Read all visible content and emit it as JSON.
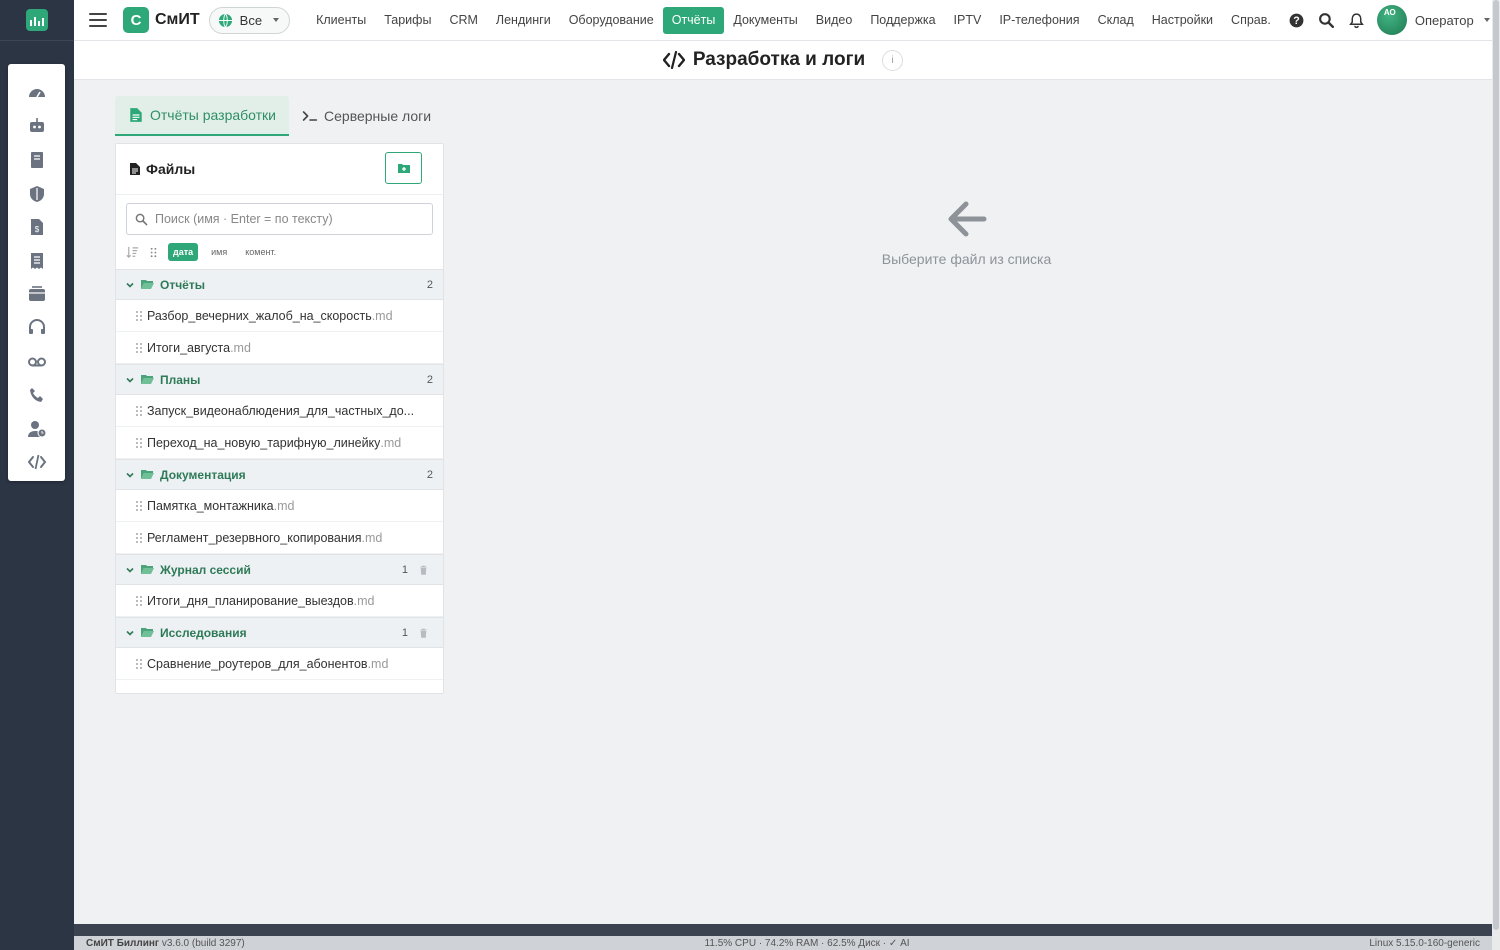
{
  "app": {
    "brand_letter": "С",
    "brand_name": "СмИТ",
    "scope_label": "Все"
  },
  "nav": {
    "items": [
      "Клиенты",
      "Тарифы",
      "CRM",
      "Лендинги",
      "Оборудование",
      "Отчёты",
      "Документы",
      "Видео",
      "Поддержка",
      "IPTV",
      "IP-телефония",
      "Склад",
      "Настройки",
      "Справ."
    ],
    "active": "Отчёты"
  },
  "user": {
    "initials": "АО",
    "name": "Оператор"
  },
  "page": {
    "title": "Разработка и логи",
    "info_label": "i"
  },
  "tabs": [
    {
      "label": "Отчёты разработки",
      "active": true
    },
    {
      "label": "Серверные логи",
      "active": false
    }
  ],
  "files_panel": {
    "title": "Файлы",
    "search_placeholder": "Поиск (имя · Enter = по тексту)",
    "sort_chips": [
      "дата",
      "имя",
      "комент."
    ],
    "sort_active": "дата",
    "folders": [
      {
        "name": "Отчёты",
        "count": "2",
        "trash": false,
        "files": [
          {
            "name": "Разбор_вечерних_жалоб_на_скорость",
            "ext": ".md"
          },
          {
            "name": "Итоги_августа",
            "ext": ".md"
          }
        ]
      },
      {
        "name": "Планы",
        "count": "2",
        "trash": false,
        "files": [
          {
            "name": "Запуск_видеонаблюдения_для_частных_до...",
            "ext": ""
          },
          {
            "name": "Переход_на_новую_тарифную_линейку",
            "ext": ".md"
          }
        ]
      },
      {
        "name": "Документация",
        "count": "2",
        "trash": false,
        "files": [
          {
            "name": "Памятка_монтажника",
            "ext": ".md"
          },
          {
            "name": "Регламент_резервного_копирования",
            "ext": ".md"
          }
        ]
      },
      {
        "name": "Журнал сессий",
        "count": "1",
        "trash": true,
        "files": [
          {
            "name": "Итоги_дня_планирование_выездов",
            "ext": ".md"
          }
        ]
      },
      {
        "name": "Исследования",
        "count": "1",
        "trash": true,
        "files": [
          {
            "name": "Сравнение_роутеров_для_абонентов",
            "ext": ".md"
          }
        ]
      }
    ]
  },
  "empty_state": {
    "text": "Выберите файл из списка"
  },
  "footer": {
    "product": "СмИТ Биллинг",
    "version": "v3.6.0 (build 3297)",
    "stats": "11.5% CPU · 74.2% RAM · 62.5% Диск · ✓ AI",
    "os": "Linux 5.15.0-160-generic"
  },
  "colors": {
    "accent": "#2ea878",
    "rail_bg": "#2b3544",
    "folder_text": "#2e7a58"
  },
  "sidebar_icons": [
    "dashboard-icon",
    "robot-icon",
    "book-icon",
    "shield-icon",
    "invoice-icon",
    "receipt-icon",
    "mailbox-icon",
    "headset-icon",
    "voicemail-icon",
    "phone-ring-icon",
    "user-clock-icon",
    "code-icon"
  ]
}
